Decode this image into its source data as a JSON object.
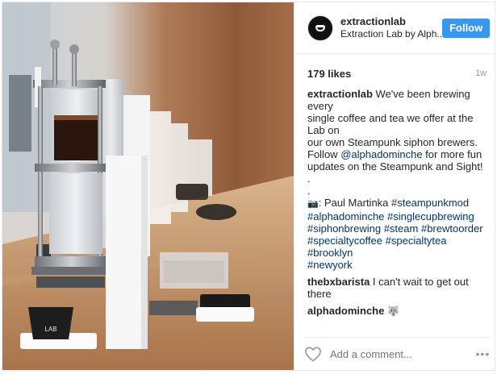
{
  "post": {
    "username": "extractionlab",
    "subtitle": "Extraction Lab by Alph..",
    "follow_label": "Follow",
    "likes": "179 likes",
    "time": "1w",
    "caption_user": "extractionlab",
    "caption_lines": [
      " We've been brewing every",
      "single coffee and tea we offer at the Lab on",
      "our own Steampunk siphon brewers."
    ],
    "follow_prefix": "Follow ",
    "mention": "@alphadominche",
    "follow_suffix": " for more fun",
    "follow_line2": "updates on the Steampunk and Sight!",
    "dot1": ".",
    "dot2": ".",
    "credit_prefix": ": Paul Martinka ",
    "hashtags": [
      "#steampunkmod",
      "#alphadominche",
      "#singlecupbrewing",
      "#siphonbrewing",
      "#steam",
      "#brewtoorder",
      "#specialtycoffee",
      "#specialtytea",
      "#brooklyn",
      "#newyork"
    ]
  },
  "comments": [
    {
      "user": "thebxbarista",
      "text": " I can't wait to get out there"
    },
    {
      "user": "alphadominche",
      "text": ""
    }
  ],
  "footer": {
    "add_comment_placeholder": "Add a comment...",
    "more": "•••"
  },
  "photo": {
    "cup_label": "LAB"
  },
  "colors": {
    "follow_button": "#3897f0",
    "link": "#003569",
    "muted": "#999999"
  }
}
